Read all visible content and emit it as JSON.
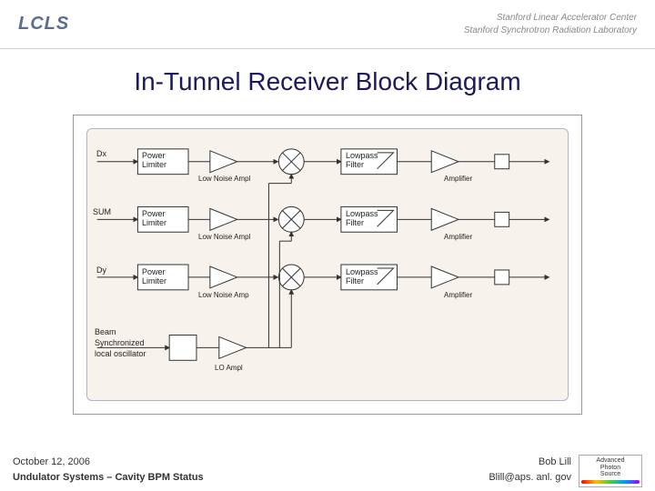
{
  "header": {
    "logo_text": "LCLS",
    "lab1": "Stanford Linear Accelerator Center",
    "lab2": "Stanford Synchrotron Radiation Laboratory"
  },
  "title": "In-Tunnel Receiver Block Diagram",
  "diagram": {
    "inputs": [
      "Dx",
      "SUM",
      "Dy"
    ],
    "oscillator_label_l1": "Beam",
    "oscillator_label_l2": "Synchronized",
    "oscillator_label_l3": "local oscillator",
    "block_power_limiter": "Power\nLimiter",
    "label_low_noise_ampl": "Low Noise Ampl",
    "label_low_noise_amp": "Low Noise Amp",
    "block_lowpass": "Lowpass\nFilter",
    "label_amplifier": "Amplifier",
    "label_lo_ampl": "LO Ampl"
  },
  "footer": {
    "date": "October 12, 2006",
    "subtitle": "Undulator Systems – Cavity BPM Status",
    "author": "Bob Lill",
    "email": "Blill@aps. anl. gov",
    "aps1": "Advanced",
    "aps2": "Photon",
    "aps3": "Source"
  }
}
